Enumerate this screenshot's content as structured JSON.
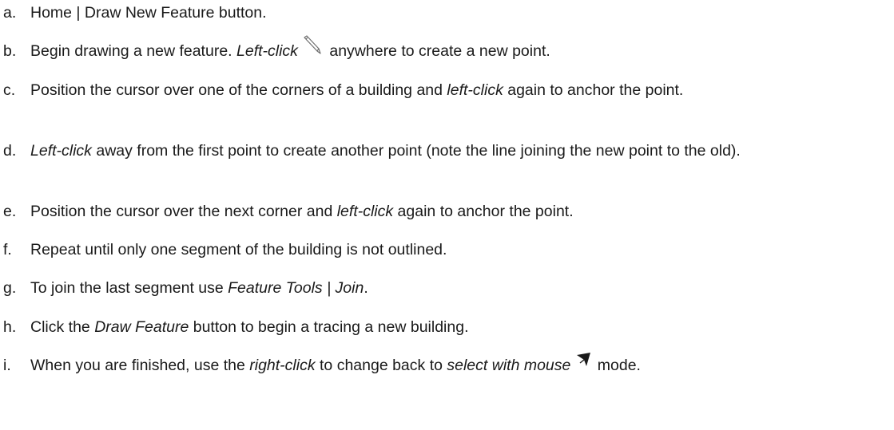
{
  "steps": [
    {
      "marker": "a.",
      "parts": [
        {
          "text": "Home | Draw New Feature button."
        }
      ]
    },
    {
      "marker": "b.",
      "parts": [
        {
          "text": "Begin drawing a new feature.  "
        },
        {
          "text": "Left-click",
          "italic": true
        },
        {
          "icon": "pencil-icon"
        },
        {
          "text": " anywhere to create a new point."
        }
      ]
    },
    {
      "marker": "c.",
      "parts": [
        {
          "text": "Position the cursor over one of the corners of a building and "
        },
        {
          "text": "left-click",
          "italic": true
        },
        {
          "text": " again to anchor the point."
        }
      ]
    },
    {
      "marker": "d.",
      "parts": [
        {
          "text": "Left-click",
          "italic": true
        },
        {
          "text": " away from the first point to create another point (note the line joining the new point to the old)."
        }
      ]
    },
    {
      "marker": "e.",
      "parts": [
        {
          "text": "Position the cursor over the next corner and "
        },
        {
          "text": "left-click",
          "italic": true
        },
        {
          "text": " again to anchor the point."
        }
      ]
    },
    {
      "marker": "f.",
      "parts": [
        {
          "text": "Repeat until only one segment of the building is not outlined."
        }
      ]
    },
    {
      "marker": "g.",
      "parts": [
        {
          "text": "To join the last segment use "
        },
        {
          "text": "Feature Tools | Join",
          "italic": true
        },
        {
          "text": "."
        }
      ]
    },
    {
      "marker": "h.",
      "parts": [
        {
          "text": "Click the "
        },
        {
          "text": "Draw Feature",
          "italic": true
        },
        {
          "text": " button to begin a tracing a new building."
        }
      ]
    },
    {
      "marker": "i.",
      "parts": [
        {
          "text": "When you are finished, use the "
        },
        {
          "text": "right-click",
          "italic": true
        },
        {
          "text": " to change back to "
        },
        {
          "text": "select with mouse",
          "italic": true
        },
        {
          "icon": "select-arrow-icon"
        },
        {
          "text": " mode."
        }
      ]
    }
  ]
}
